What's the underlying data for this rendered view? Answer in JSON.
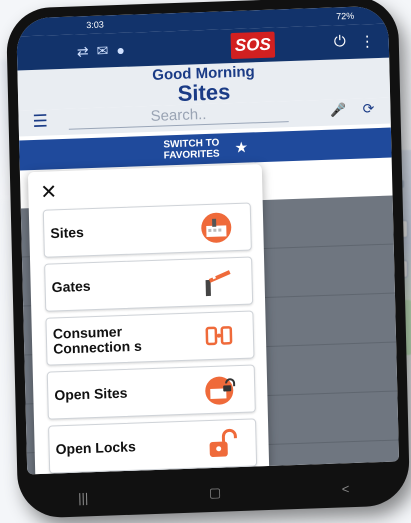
{
  "status": {
    "time": "3:03",
    "battery": "72%"
  },
  "app": {
    "logo_text": "SOS",
    "greeting": "Good Morning",
    "title": "Sites"
  },
  "search": {
    "placeholder": "Search.."
  },
  "favorites_button": {
    "line1": "SWITCH TO",
    "line2": "FAVORITES"
  },
  "menu": {
    "items": [
      {
        "label": "Sites",
        "icon": "sites-icon"
      },
      {
        "label": "Gates",
        "icon": "gate-barrier-icon"
      },
      {
        "label": "Consumer Connection s",
        "icon": "consumer-connection-icon"
      },
      {
        "label": "Open Sites",
        "icon": "open-sites-icon"
      },
      {
        "label": "Open Locks",
        "icon": "open-lock-icon"
      }
    ]
  },
  "colors": {
    "header": "#12336b",
    "accent": "#1f4a9c",
    "icon_orange": "#ef6a3a",
    "logo_red": "#d22020"
  }
}
